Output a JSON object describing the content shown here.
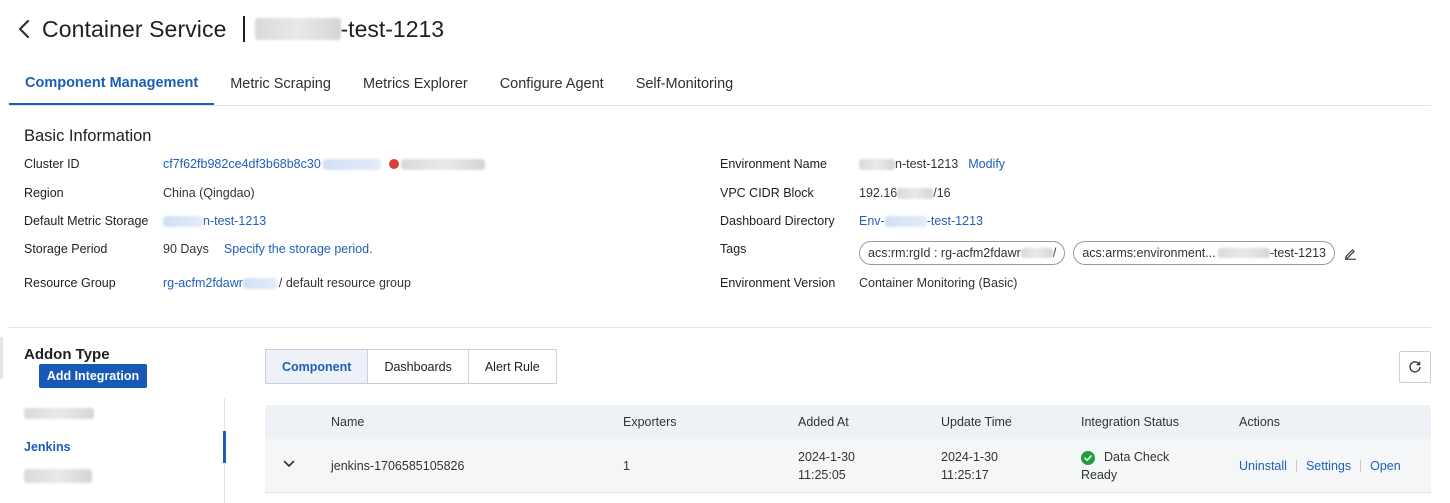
{
  "header": {
    "title": "Container Service",
    "env_suffix": "-test-1213"
  },
  "tabs": [
    {
      "label": "Component Management"
    },
    {
      "label": "Metric Scraping"
    },
    {
      "label": "Metrics Explorer"
    },
    {
      "label": "Configure Agent"
    },
    {
      "label": "Self-Monitoring"
    }
  ],
  "basic_info": {
    "title": "Basic Information",
    "cluster_id_label": "Cluster ID",
    "cluster_id": "cf7f62fb982ce4df3b68b8c30",
    "region_label": "Region",
    "region": "China (Qingdao)",
    "storage_label": "Default Metric Storage",
    "storage": "n-test-1213",
    "period_label": "Storage Period",
    "period": "90 Days",
    "period_link": "Specify the storage period.",
    "rg_label": "Resource Group",
    "rg_link": "rg-acfm2fdawr",
    "rg_suffix": "/ default resource group",
    "env_name_label": "Environment Name",
    "env_name": "n-test-1213",
    "modify": "Modify",
    "vpc_label": "VPC CIDR Block",
    "vpc_prefix": "192.16",
    "vpc_suffix": "/16",
    "dashdir_label": "Dashboard Directory",
    "dashdir_prefix": "Env-",
    "dashdir_suffix": "-test-1213",
    "tags_label": "Tags",
    "tag1": "acs:rm:rgId : rg-acfm2fdawr",
    "tag1_end": "/",
    "tag2": "acs:arms:environment...",
    "tag2_end": "-test-1213",
    "version_label": "Environment Version",
    "version": "Container Monitoring (Basic)"
  },
  "addon": {
    "title": "Addon Type",
    "add_button": "Add Integration",
    "active_item": "Jenkins"
  },
  "subtabs": [
    {
      "label": "Component"
    },
    {
      "label": "Dashboards"
    },
    {
      "label": "Alert Rule"
    }
  ],
  "table": {
    "columns": [
      "Name",
      "Exporters",
      "Added At",
      "Update Time",
      "Integration Status",
      "Actions"
    ],
    "rows": [
      {
        "name": "jenkins-1706585105826",
        "exporters": "1",
        "added_date": "2024-1-30",
        "added_time": "11:25:05",
        "update_date": "2024-1-30",
        "update_time": "11:25:17",
        "status_line1": "Data Check",
        "status_line2": "Ready",
        "actions": [
          "Uninstall",
          "Settings",
          "Open"
        ]
      }
    ]
  },
  "colors": {
    "accent": "#1a5fb4",
    "primary_button": "#1659b6",
    "success": "#1f9d3f"
  }
}
